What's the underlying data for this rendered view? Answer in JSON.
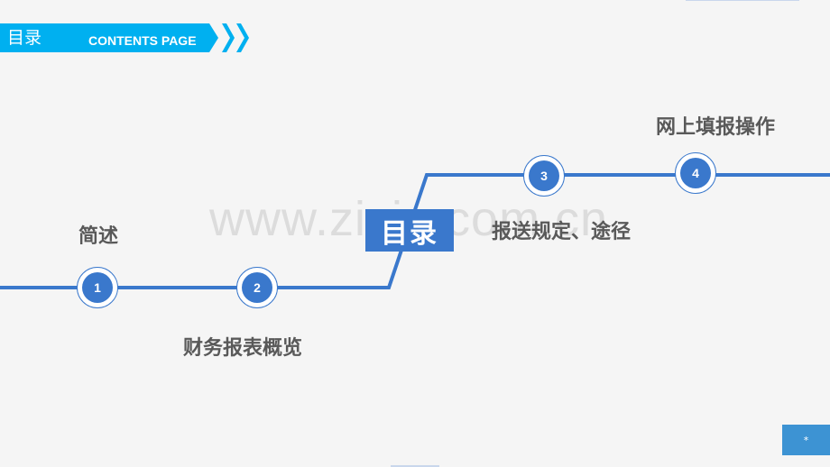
{
  "header": {
    "title_cn": "目录",
    "title_en": "CONTENTS PAGE",
    "accent_color": "#00b0f0"
  },
  "center_title": "目录",
  "watermark": "www.zixin.com.cn",
  "timeline": {
    "line_color": "#3a78cc",
    "items": [
      {
        "number": "1",
        "label": "简述"
      },
      {
        "number": "2",
        "label": "财务报表概览"
      },
      {
        "number": "3",
        "label": "报送规定、途径"
      },
      {
        "number": "4",
        "label": "网上填报操作"
      }
    ]
  },
  "page_badge": "*"
}
